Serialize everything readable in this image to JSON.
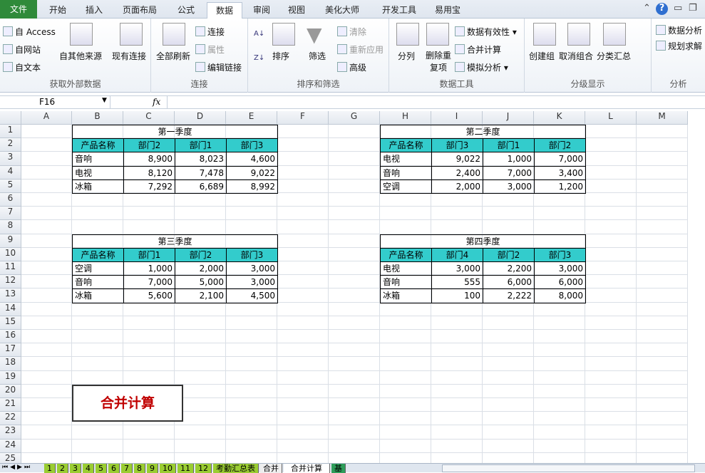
{
  "menu_tabs": [
    "文件",
    "开始",
    "插入",
    "页面布局",
    "公式",
    "数据",
    "审阅",
    "视图",
    "美化大师",
    "开发工具",
    "易用宝"
  ],
  "active_tab": "数据",
  "ribbon": {
    "groups": [
      {
        "label": "获取外部数据",
        "items": [
          "自 Access",
          "自网站",
          "自文本",
          "自其他来源",
          "现有连接"
        ]
      },
      {
        "label": "连接",
        "items": [
          "全部刷新",
          "连接",
          "属性",
          "编辑链接"
        ]
      },
      {
        "label": "排序和筛选",
        "items": [
          "排序",
          "筛选",
          "清除",
          "重新应用",
          "高级"
        ]
      },
      {
        "label": "数据工具",
        "items": [
          "分列",
          "删除重复项",
          "数据有效性",
          "合并计算",
          "模拟分析"
        ]
      },
      {
        "label": "分级显示",
        "items": [
          "创建组",
          "取消组合",
          "分类汇总"
        ]
      },
      {
        "label": "分析",
        "items": [
          "数据分析",
          "规划求解"
        ]
      }
    ]
  },
  "formula_bar": {
    "name_box": "F16",
    "fx": "fx",
    "formula": ""
  },
  "columns": [
    "A",
    "B",
    "C",
    "D",
    "E",
    "F",
    "G",
    "H",
    "I",
    "J",
    "K",
    "L",
    "M"
  ],
  "rows": 25,
  "tables": [
    {
      "title": "第一季度",
      "col": 1,
      "row": 1,
      "headers": [
        "产品名称",
        "部门2",
        "部门1",
        "部门3"
      ],
      "data": [
        [
          "音响",
          "8,900",
          "8,023",
          "4,600"
        ],
        [
          "电视",
          "8,120",
          "7,478",
          "9,022"
        ],
        [
          "冰箱",
          "7,292",
          "6,689",
          "8,992"
        ]
      ]
    },
    {
      "title": "第二季度",
      "col": 7,
      "row": 1,
      "headers": [
        "产品名称",
        "部门3",
        "部门1",
        "部门2"
      ],
      "data": [
        [
          "电视",
          "9,022",
          "1,000",
          "7,000"
        ],
        [
          "音响",
          "2,400",
          "7,000",
          "3,400"
        ],
        [
          "空调",
          "2,000",
          "3,000",
          "1,200"
        ]
      ]
    },
    {
      "title": "第三季度",
      "col": 1,
      "row": 9,
      "headers": [
        "产品名称",
        "部门1",
        "部门2",
        "部门3"
      ],
      "data": [
        [
          "空调",
          "1,000",
          "2,000",
          "3,000"
        ],
        [
          "音响",
          "7,000",
          "5,000",
          "3,000"
        ],
        [
          "冰箱",
          "5,600",
          "2,100",
          "4,500"
        ]
      ]
    },
    {
      "title": "第四季度",
      "col": 7,
      "row": 9,
      "headers": [
        "产品名称",
        "部门4",
        "部门2",
        "部门3"
      ],
      "data": [
        [
          "电视",
          "3,000",
          "2,200",
          "3,000"
        ],
        [
          "音响",
          "555",
          "6,000",
          "6,000"
        ],
        [
          "冰箱",
          "100",
          "2,222",
          "8,000"
        ]
      ]
    }
  ],
  "button_label": "合并计算",
  "sheet_tabs": [
    "1",
    "2",
    "3",
    "4",
    "5",
    "6",
    "7",
    "8",
    "9",
    "10",
    "11",
    "12",
    "考勤汇总表",
    "合并",
    "合并计算",
    "基"
  ],
  "active_sheet": "合并计算",
  "colors": {
    "header_fill": "#33cccc",
    "button_text": "#c00000",
    "file_tab": "#2f8a3a"
  }
}
